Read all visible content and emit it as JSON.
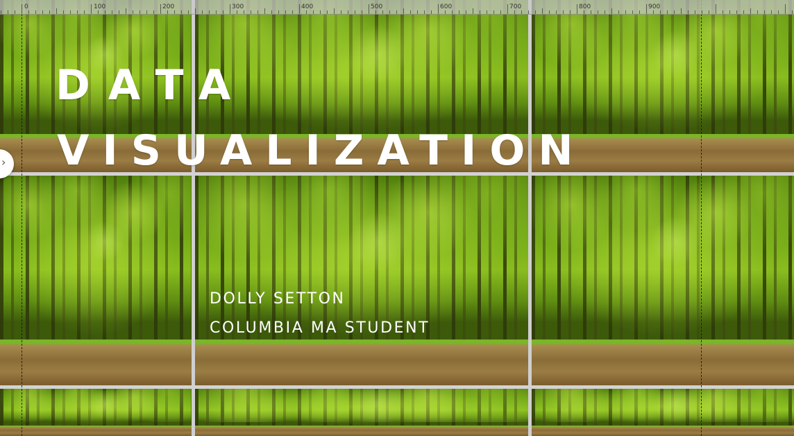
{
  "slide": {
    "title_line1": "DATA",
    "title_line2": "VISUALIZATION",
    "author": "DOLLY SETTON",
    "affiliation": "COLUMBIA MA STUDENT"
  },
  "ruler": {
    "labels": [
      "0",
      "100",
      "200",
      "300",
      "400",
      "500",
      "600",
      "700",
      "800",
      "900"
    ]
  },
  "icons": {
    "edge_handle": "chevron-right-icon"
  }
}
